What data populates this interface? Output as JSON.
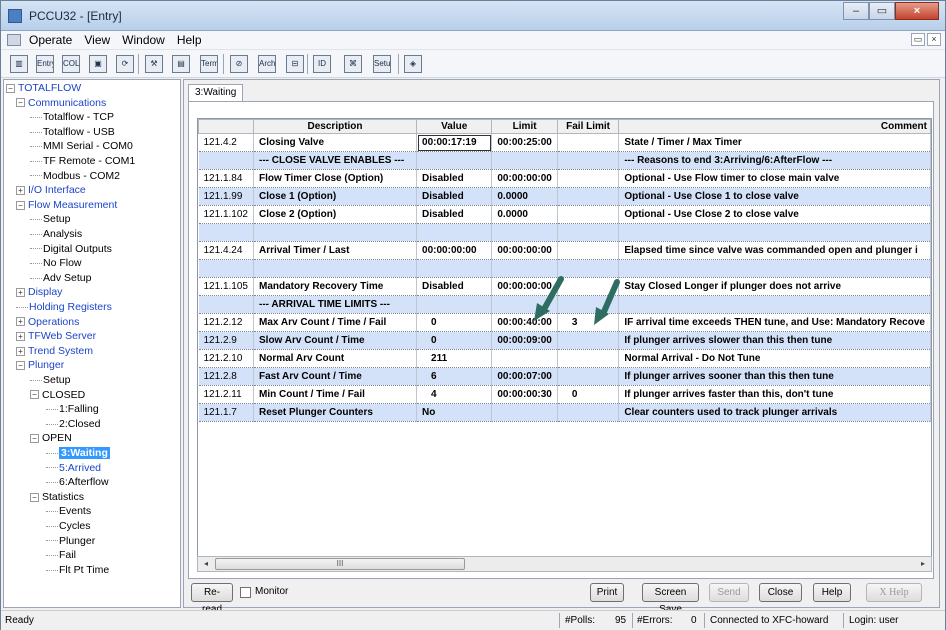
{
  "window": {
    "title": "PCCU32 - [Entry]"
  },
  "menu": [
    "Operate",
    "View",
    "Window",
    "Help"
  ],
  "toolbar": [
    {
      "name": "connect-icon",
      "glyph": "▥"
    },
    {
      "name": "entry-icon",
      "glyph": "Entry"
    },
    {
      "name": "collect-icon",
      "glyph": "COLLECT"
    },
    {
      "name": "calibrate-icon",
      "glyph": "▣"
    },
    {
      "name": "folder-refresh-icon",
      "glyph": "⟳"
    },
    {
      "name": "tools-icon",
      "glyph": "⚒"
    },
    {
      "name": "report-icon",
      "glyph": "▤"
    },
    {
      "name": "terminal-icon",
      "glyph": "Terminal"
    },
    {
      "name": "link-icon",
      "glyph": "⊘"
    },
    {
      "name": "archive-icon",
      "glyph": "Archive"
    },
    {
      "name": "save-icon",
      "glyph": "⊟"
    },
    {
      "name": "id-icon",
      "glyph": "ID"
    },
    {
      "name": "loader-icon",
      "glyph": "⌘"
    },
    {
      "name": "setup-icon",
      "glyph": "Setup"
    },
    {
      "name": "help-book-icon",
      "glyph": "◈"
    }
  ],
  "mdi": {
    "restore": "▭",
    "close": "×"
  },
  "tree": [
    {
      "label": "TOTALFLOW",
      "level": 0,
      "exp": "-",
      "color": "blue"
    },
    {
      "label": "Communications",
      "level": 1,
      "exp": "-",
      "color": "blue"
    },
    {
      "label": "Totalflow - TCP",
      "level": 2,
      "exp": ""
    },
    {
      "label": "Totalflow - USB",
      "level": 2,
      "exp": ""
    },
    {
      "label": "MMI Serial - COM0",
      "level": 2,
      "exp": ""
    },
    {
      "label": "TF Remote - COM1",
      "level": 2,
      "exp": ""
    },
    {
      "label": "Modbus - COM2",
      "level": 2,
      "exp": ""
    },
    {
      "label": "I/O Interface",
      "level": 1,
      "exp": "+",
      "color": "blue"
    },
    {
      "label": "Flow Measurement",
      "level": 1,
      "exp": "-",
      "color": "blue"
    },
    {
      "label": "Setup",
      "level": 2,
      "exp": ""
    },
    {
      "label": "Analysis",
      "level": 2,
      "exp": ""
    },
    {
      "label": "Digital Outputs",
      "level": 2,
      "exp": ""
    },
    {
      "label": "No Flow",
      "level": 2,
      "exp": ""
    },
    {
      "label": "Adv Setup",
      "level": 2,
      "exp": ""
    },
    {
      "label": "Display",
      "level": 1,
      "exp": "+",
      "color": "blue"
    },
    {
      "label": "Holding Registers",
      "level": 1,
      "exp": "",
      "color": "blue"
    },
    {
      "label": "Operations",
      "level": 1,
      "exp": "+",
      "color": "blue"
    },
    {
      "label": "TFWeb Server",
      "level": 1,
      "exp": "+",
      "color": "blue"
    },
    {
      "label": "Trend System",
      "level": 1,
      "exp": "+",
      "color": "blue"
    },
    {
      "label": "Plunger",
      "level": 1,
      "exp": "-",
      "color": "blue"
    },
    {
      "label": "Setup",
      "level": 2,
      "exp": ""
    },
    {
      "label": "CLOSED",
      "level": 2,
      "exp": "-"
    },
    {
      "label": "1:Falling",
      "level": 3,
      "exp": ""
    },
    {
      "label": "2:Closed",
      "level": 3,
      "exp": ""
    },
    {
      "label": "OPEN",
      "level": 2,
      "exp": "-"
    },
    {
      "label": "3:Waiting",
      "level": 3,
      "exp": "",
      "selected": true
    },
    {
      "label": "5:Arrived",
      "level": 3,
      "exp": "",
      "color": "blue"
    },
    {
      "label": "6:Afterflow",
      "level": 3,
      "exp": ""
    },
    {
      "label": "Statistics",
      "level": 2,
      "exp": "-"
    },
    {
      "label": "Events",
      "level": 3,
      "exp": ""
    },
    {
      "label": "Cycles",
      "level": 3,
      "exp": ""
    },
    {
      "label": "Plunger",
      "level": 3,
      "exp": ""
    },
    {
      "label": "Fail",
      "level": 3,
      "exp": ""
    },
    {
      "label": "Flt Pt Time",
      "level": 3,
      "exp": ""
    }
  ],
  "tab": "3:Waiting",
  "grid": {
    "headers": [
      "",
      "Description",
      "Value",
      "Limit",
      "Fail Limit",
      "Comment"
    ],
    "rows": [
      {
        "id": "121.4.2",
        "desc": "Closing Valve",
        "value": "00:00:17:19",
        "limit": "00:00:25:00",
        "fail": "",
        "comment": "State / Timer / Max Timer",
        "bg": "white",
        "focus": true
      },
      {
        "id": "",
        "desc": "--- CLOSE VALVE ENABLES ---",
        "value": "",
        "limit": "",
        "fail": "",
        "comment": "--- Reasons to end 3:Arriving/6:AfterFlow ---",
        "bg": "blue"
      },
      {
        "id": "121.1.84",
        "desc": "Flow Timer Close (Option)",
        "value": "Disabled",
        "limit": "00:00:00:00",
        "fail": "",
        "comment": "Optional - Use Flow timer to close main valve",
        "bg": "white"
      },
      {
        "id": "121.1.99",
        "desc": "Close 1 (Option)",
        "value": "Disabled",
        "limit": "0.0000",
        "fail": "",
        "comment": "Optional - Use Close 1 to close valve",
        "bg": "blue"
      },
      {
        "id": "121.1.102",
        "desc": "Close 2 (Option)",
        "value": "Disabled",
        "limit": "0.0000",
        "fail": "",
        "comment": "Optional - Use Close 2 to close valve",
        "bg": "white"
      },
      {
        "id": "",
        "desc": "",
        "value": "",
        "limit": "",
        "fail": "",
        "comment": "",
        "bg": "blue"
      },
      {
        "id": "121.4.24",
        "desc": "Arrival Timer / Last",
        "value": "00:00:00:00",
        "limit": "00:00:00:00",
        "fail": "",
        "comment": "Elapsed time since valve was commanded open and plunger i",
        "bg": "white"
      },
      {
        "id": "",
        "desc": "",
        "value": "",
        "limit": "",
        "fail": "",
        "comment": "",
        "bg": "blue"
      },
      {
        "id": "121.1.105",
        "desc": "Mandatory Recovery Time",
        "value": "Disabled",
        "limit": "00:00:00:00",
        "fail": "",
        "comment": "Stay Closed Longer if plunger does not arrive",
        "bg": "white"
      },
      {
        "id": "",
        "desc": "--- ARRIVAL TIME LIMITS ---",
        "value": "",
        "limit": "",
        "fail": "",
        "comment": "",
        "bg": "blue"
      },
      {
        "id": "121.2.12",
        "desc": "Max Arv Count / Time / Fail",
        "value": "0",
        "limit": "00:00:40:00",
        "fail": "3",
        "comment": "IF arrival time exceeds THEN tune, and Use: Mandatory Recove",
        "bg": "white",
        "center": true
      },
      {
        "id": "121.2.9",
        "desc": "Slow Arv Count / Time",
        "value": "0",
        "limit": "00:00:09:00",
        "fail": "",
        "comment": "If plunger arrives slower than this then tune",
        "bg": "blue",
        "center": true
      },
      {
        "id": "121.2.10",
        "desc": "Normal Arv Count",
        "value": "211",
        "limit": "",
        "fail": "",
        "comment": "Normal Arrival - Do Not Tune",
        "bg": "white",
        "center": true
      },
      {
        "id": "121.2.8",
        "desc": "Fast Arv Count / Time",
        "value": "6",
        "limit": "00:00:07:00",
        "fail": "",
        "comment": "If plunger arrives sooner than this then tune",
        "bg": "blue",
        "center": true
      },
      {
        "id": "121.2.11",
        "desc": "Min Count / Time / Fail",
        "value": "4",
        "limit": "00:00:00:30",
        "fail": "0",
        "comment": "If plunger arrives faster than this, don't tune",
        "bg": "white",
        "center": true
      },
      {
        "id": "121.1.7",
        "desc": "Reset Plunger Counters",
        "value": "No",
        "limit": "",
        "fail": "",
        "comment": "Clear counters used to track plunger arrivals",
        "bg": "blue"
      }
    ]
  },
  "scroll": {
    "left": "◂",
    "right": "▸",
    "thumb": "III"
  },
  "buttons": {
    "reread": "Re-read",
    "monitor": "Monitor",
    "print": "Print",
    "screen_save": "Screen Save",
    "send": "Send",
    "close": "Close",
    "help": "Help",
    "xhelp": "X Help"
  },
  "status": {
    "ready": "Ready",
    "polls_label": "#Polls:",
    "polls": "95",
    "errors_label": "#Errors:",
    "errors": "0",
    "connection": "Connected to XFC-howard",
    "login": "Login: user"
  },
  "colors": {
    "annotation_arrow": "#2e6e62",
    "row_blue": "#d4e2f9",
    "tree_link": "#1d44c9",
    "selection": "#3399ff"
  }
}
